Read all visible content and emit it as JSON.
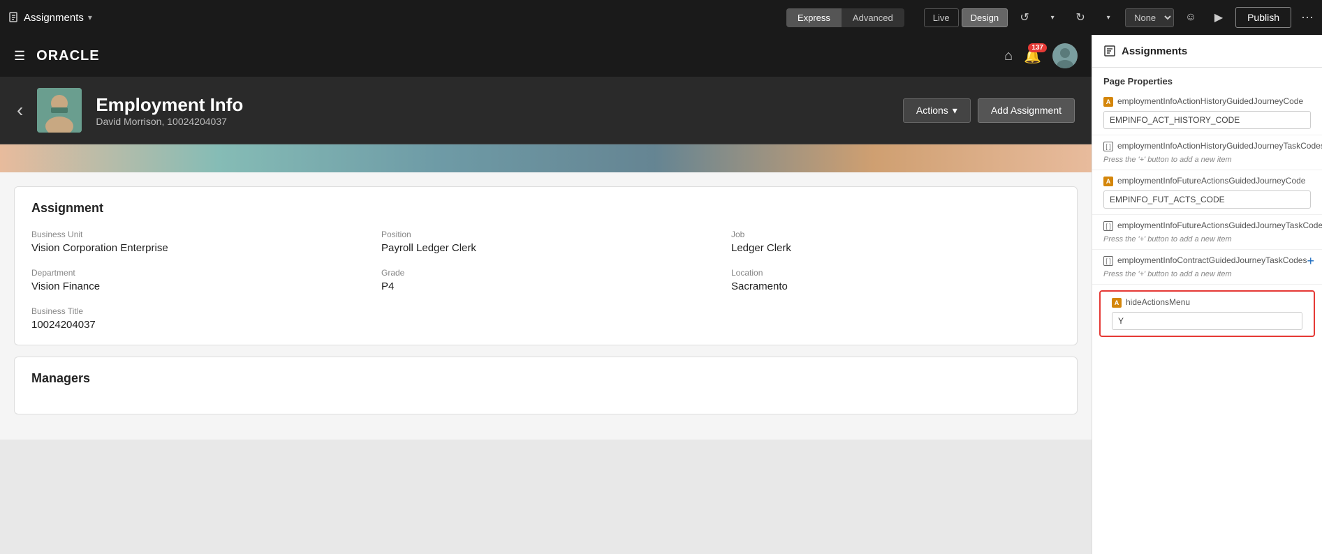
{
  "toolbar": {
    "app_title": "Assignments",
    "app_caret": "▾",
    "express_label": "Express",
    "advanced_label": "Advanced",
    "live_label": "Live",
    "design_label": "Design",
    "none_label": "None",
    "publish_label": "Publish",
    "undo_icon": "↺",
    "redo_icon": "↻",
    "play_icon": "▶",
    "smiley_icon": "☺",
    "dots_icon": "···"
  },
  "oracle_header": {
    "logo": "ORACLE",
    "bell_count": "137"
  },
  "emp_banner": {
    "back_icon": "‹",
    "name": "Employment Info",
    "employee_id": "David Morrison, 10024204037",
    "actions_label": "Actions",
    "actions_caret": "▾",
    "add_assignment_label": "Add Assignment"
  },
  "assignment_section": {
    "title": "Assignment",
    "fields": [
      {
        "label": "Business Unit",
        "value": "Vision Corporation Enterprise"
      },
      {
        "label": "Position",
        "value": "Payroll Ledger Clerk"
      },
      {
        "label": "Job",
        "value": "Ledger Clerk"
      },
      {
        "label": "Department",
        "value": "Vision Finance"
      },
      {
        "label": "Grade",
        "value": "P4"
      },
      {
        "label": "Location",
        "value": "Sacramento"
      },
      {
        "label": "Business Title",
        "value": "10024204037"
      }
    ]
  },
  "managers_section": {
    "title": "Managers"
  },
  "right_panel": {
    "title": "Assignments",
    "section_title": "Page Properties",
    "items": [
      {
        "id": "empInfoActionHistoryGuidedJourneyCode",
        "label": "employmentInfoActionHistoryGuidedJourneyCode",
        "type": "A",
        "input_value": "EMPINFO_ACT_HISTORY_CODE",
        "has_input": true
      },
      {
        "id": "empInfoActionHistoryGuidedJourneyTaskCodes",
        "label": "employmentInfoActionHistoryGuidedJourneyTaskCodes",
        "type": "bracket",
        "hint": "Press the '+' button to add a new item",
        "has_add": true
      },
      {
        "id": "empInfoFutureActionsGuidedJourneyCode",
        "label": "employmentInfoFutureActionsGuidedJourneyCode",
        "type": "A",
        "input_value": "EMPINFO_FUT_ACTS_CODE",
        "has_input": true
      },
      {
        "id": "empInfoFutureActionsGuidedJourneyTaskCodes",
        "label": "employmentInfoFutureActionsGuidedJourneyTaskCodes",
        "type": "bracket",
        "hint": "Press the '+' button to add a new item",
        "has_add": true
      },
      {
        "id": "empInfoContractGuidedJourneyTaskCodes",
        "label": "employmentInfoContractGuidedJourneyTaskCodes",
        "type": "bracket",
        "hint": "Press the '+' button to add a new item",
        "has_add": true
      }
    ],
    "highlighted_item": {
      "label": "hideActionsMenu",
      "type": "A",
      "input_value": "Y"
    }
  }
}
